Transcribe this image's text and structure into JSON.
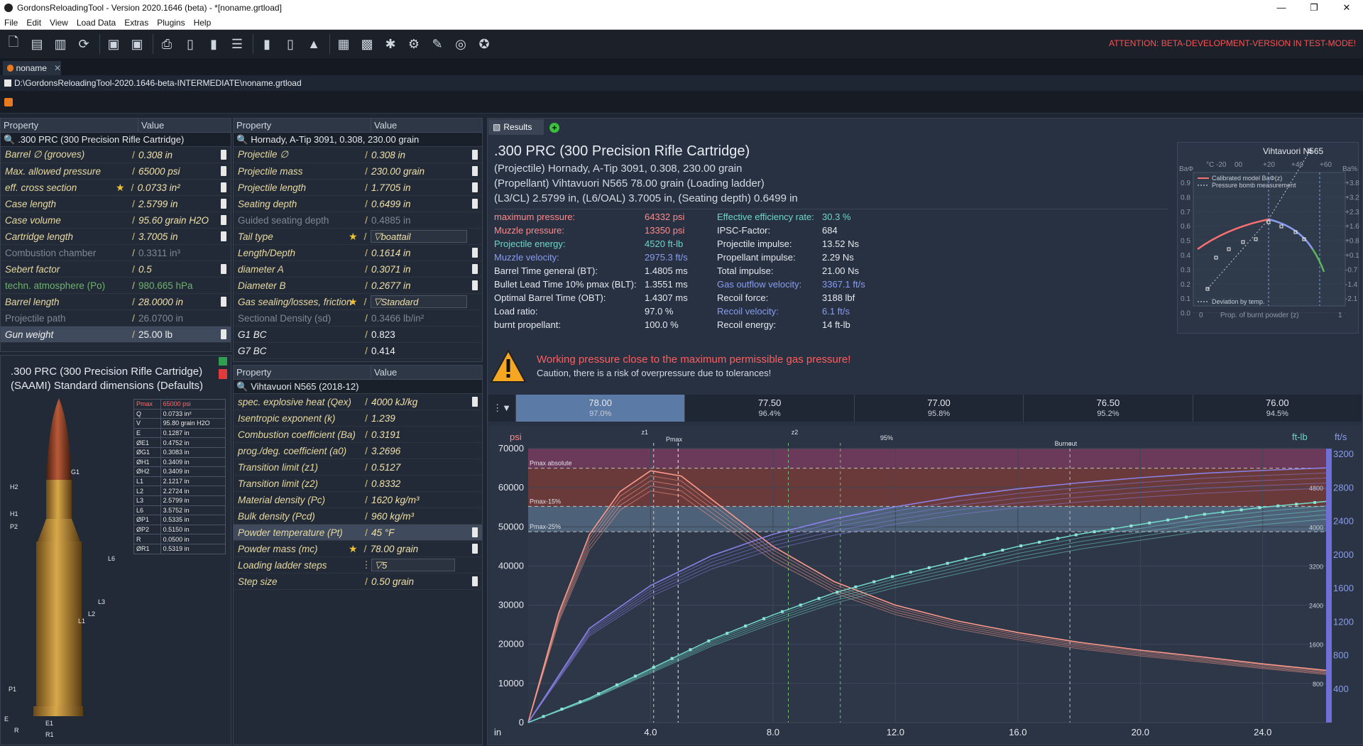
{
  "window": {
    "title": "GordonsReloadingTool - Version 2020.1646 (beta) - *[noname.grtload]",
    "btn_min": "—",
    "btn_max": "❐",
    "btn_close": "✕"
  },
  "menu": [
    "File",
    "Edit",
    "View",
    "Load Data",
    "Extras",
    "Plugins",
    "Help"
  ],
  "attention": "ATTENTION: BETA-DEVELOPMENT-VERSION IN TEST-MODE!",
  "doc_tab": {
    "label": "noname",
    "close": "✕"
  },
  "path": "D:\\GordonsReloadingTool-2020.1646-beta-INTERMEDIATE\\noname.grtload",
  "cartridge_panel": {
    "header_property": "Property",
    "header_value": "Value",
    "title": ".300 PRC (300 Precision Rifle Cartridge)",
    "rows": [
      {
        "k": "Barrel ∅ (grooves)",
        "v": "0.308 in"
      },
      {
        "k": "Max. allowed pressure",
        "v": "65000 psi"
      },
      {
        "k": "eff. cross section",
        "v": "0.0733 in²"
      },
      {
        "k": "Case length",
        "v": "2.5799 in"
      },
      {
        "k": "Case volume",
        "v": "95.60 grain H2O"
      },
      {
        "k": "Cartridge length",
        "v": "3.7005 in"
      },
      {
        "k": "Combustion chamber",
        "v": "0.3311 in³"
      },
      {
        "k": "Sebert factor",
        "v": "0.5"
      },
      {
        "k": "techn. atmosphere (Po)",
        "v": "980.665 hPa"
      },
      {
        "k": "Barrel length",
        "v": "28.0000 in"
      },
      {
        "k": "Projectile path",
        "v": "26.0700 in"
      },
      {
        "k": "Gun weight",
        "v": "25.00 lb"
      }
    ]
  },
  "projectile_panel": {
    "header_property": "Property",
    "header_value": "Value",
    "title": "Hornady, A-Tip 3091, 0.308, 230.00 grain",
    "rows": [
      {
        "k": "Projectile ∅",
        "v": "0.308 in"
      },
      {
        "k": "Projectile mass",
        "v": "230.00 grain"
      },
      {
        "k": "Projectile length",
        "v": "1.7705 in"
      },
      {
        "k": "Seating depth",
        "v": "0.6499 in"
      },
      {
        "k": "Guided seating depth",
        "v": "0.4885 in"
      },
      {
        "k": "Tail type",
        "v": "boattail"
      },
      {
        "k": "Length/Depth",
        "v": "0.1614 in"
      },
      {
        "k": "diameter A",
        "v": "0.3071 in"
      },
      {
        "k": "Diameter B",
        "v": "0.2677 in"
      },
      {
        "k": "Gas sealing/losses, friction",
        "v": "Standard"
      },
      {
        "k": "Sectional Density (sd)",
        "v": "0.3466 lb/in²"
      },
      {
        "k": "G1 BC",
        "v": "0.823"
      },
      {
        "k": "G7 BC",
        "v": "0.414"
      }
    ]
  },
  "propellant_panel": {
    "header_property": "Property",
    "header_value": "Value",
    "title": "Vihtavuori N565 (2018-12)",
    "rows": [
      {
        "k": "spec. explosive heat (Qex)",
        "v": "4000 kJ/kg"
      },
      {
        "k": "Isentropic exponent (k)",
        "v": "1.239"
      },
      {
        "k": "Combustion coefficient (Ba)",
        "v": "0.3191"
      },
      {
        "k": "prog./deg. coefficient (a0)",
        "v": "3.2696"
      },
      {
        "k": "Transition limit (z1)",
        "v": "0.5127"
      },
      {
        "k": "Transition limit (z2)",
        "v": "0.8332"
      },
      {
        "k": "Material density (Pc)",
        "v": "1620 kg/m³"
      },
      {
        "k": "Bulk density (Pcd)",
        "v": "960 kg/m³"
      },
      {
        "k": "Powder temperature (Pt)",
        "v": "45 °F"
      },
      {
        "k": "Powder mass (mc)",
        "v": "78.00 grain"
      },
      {
        "k": "Loading ladder steps",
        "v": "5"
      },
      {
        "k": "Step size",
        "v": "0.50 grain"
      }
    ]
  },
  "cartridge_drawing": {
    "title1": ".300 PRC (300 Precision Rifle Cartridge)",
    "title2": "(SAAMI) Standard dimensions (Defaults)",
    "dims": [
      [
        "Pmax",
        "65000 psi"
      ],
      [
        "Q",
        "0.0733 in²"
      ],
      [
        "V",
        "95.80 grain H2O"
      ],
      [
        "E",
        "0.1287 in"
      ],
      [
        "ØE1",
        "0.4752 in"
      ],
      [
        "ØG1",
        "0.3083 in"
      ],
      [
        "ØH1",
        "0.3409 in"
      ],
      [
        "ØH2",
        "0.3409 in"
      ],
      [
        "L1",
        "2.1217 in"
      ],
      [
        "L2",
        "2.2724 in"
      ],
      [
        "L3",
        "2.5799 in"
      ],
      [
        "L6",
        "3.5752 in"
      ],
      [
        "ØP1",
        "0.5335 in"
      ],
      [
        "ØP2",
        "0.5150 in"
      ],
      [
        "R",
        "0.0500 in"
      ],
      [
        "ØR1",
        "0.5319 in"
      ]
    ],
    "labels": [
      "G1",
      "H2",
      "H1",
      "P2",
      "L6",
      "L3",
      "L2",
      "L1",
      "P1",
      "E1",
      "R1",
      "E",
      "R"
    ]
  },
  "results": {
    "tab": "Results",
    "title": ".300 PRC (300 Precision Rifle Cartridge)",
    "sub1": "(Projectile) Hornady, A-Tip 3091, 0.308, 230.00 grain",
    "sub2": "(Propellant) Vihtavuori N565 78.00 grain (Loading ladder)",
    "sub3": "(L3/CL) 2.5799 in, (L6/OAL) 3.7005 in, (Seating depth) 0.6499 in",
    "col1": [
      {
        "k": "maximum pressure:",
        "v": "64332 psi",
        "c": "#ff8a8a"
      },
      {
        "k": "Muzzle pressure:",
        "v": "13350 psi",
        "c": "#ff8a8a"
      },
      {
        "k": "Projectile energy:",
        "v": "4520 ft-lb",
        "c": "#6fd6c6"
      },
      {
        "k": "Muzzle velocity:",
        "v": "2975.3 ft/s",
        "c": "#8a9cf0"
      },
      {
        "k": "Barrel Time general (BT):",
        "v": "1.4805 ms",
        "c": "#e6e9ee"
      },
      {
        "k": "Bullet Lead Time 10% pmax (BLT):",
        "v": "1.3551 ms",
        "c": "#e6e9ee"
      },
      {
        "k": "Optimal Barrel Time (OBT):",
        "v": "1.4307 ms",
        "c": "#e6e9ee"
      },
      {
        "k": "Load ratio:",
        "v": "97.0 %",
        "c": "#e6e9ee"
      },
      {
        "k": "burnt propellant:",
        "v": "100.0 %",
        "c": "#e6e9ee"
      }
    ],
    "col2": [
      {
        "k": "Effective efficiency rate:",
        "v": "30.3 %",
        "c": "#6fd6c6"
      },
      {
        "k": "IPSC-Factor:",
        "v": "684",
        "c": "#e6e9ee"
      },
      {
        "k": "Projectile impulse:",
        "v": "13.52 Ns",
        "c": "#e6e9ee"
      },
      {
        "k": "Propellant impulse:",
        "v": "2.29 Ns",
        "c": "#e6e9ee"
      },
      {
        "k": "Total impulse:",
        "v": "21.00 Ns",
        "c": "#e6e9ee"
      },
      {
        "k": "Gas outflow velocity:",
        "v": "3367.1 ft/s",
        "c": "#8a9cf0"
      },
      {
        "k": "Recoil force:",
        "v": "3188 lbf",
        "c": "#e6e9ee"
      },
      {
        "k": "Recoil velocity:",
        "v": "6.1 ft/s",
        "c": "#8a9cf0"
      },
      {
        "k": "Recoil energy:",
        "v": "14 ft-lb",
        "c": "#e6e9ee"
      }
    ],
    "warning_title": "Working pressure close to the maximum permissible gas pressure!",
    "warning_text": "Caution, there is a risk of overpressure due to tolerances!",
    "ladder": [
      {
        "mass": "78.00",
        "pct": "97.0%"
      },
      {
        "mass": "77.50",
        "pct": "96.4%"
      },
      {
        "mass": "77.00",
        "pct": "95.8%"
      },
      {
        "mass": "76.50",
        "pct": "95.2%"
      },
      {
        "mass": "76.00",
        "pct": "94.5%"
      }
    ]
  },
  "mini_chart": {
    "title": "Vihtavuori N565",
    "legend1": "Calibrated model BaΦ(z)",
    "legend2": "Pressure bomb measurement",
    "legend3": "Deviation by temp.",
    "xlabel": "Prop. of burnt powder (z)",
    "top_axis": [
      "°C -20",
      "00",
      "+20",
      "+40",
      "+60"
    ],
    "left_ticks": [
      "0.9",
      "0.8",
      "0.7",
      "0.6",
      "0.5",
      "0.4",
      "0.3",
      "0.2",
      "0.1",
      "0.0"
    ],
    "right_ticks": [
      "+3.8",
      "+3.2",
      "+2.3",
      "+1.6",
      "+0.8",
      "+0.1",
      "-0.7",
      "-1.4",
      "-2.1"
    ],
    "left_label": "BaΦ",
    "right_label": "Ba%",
    "x0": "0",
    "x1": "1"
  },
  "chart_data": {
    "type": "line",
    "xlabel": "in",
    "x_ticks": [
      "4.0",
      "8.0",
      "12.0",
      "16.0",
      "20.0",
      "24.0"
    ],
    "y_left_label": "psi",
    "y_left_ticks": [
      "70000",
      "60000",
      "50000",
      "40000",
      "30000",
      "20000",
      "10000",
      "0"
    ],
    "y_right1_label": "ft-lb",
    "y_right1_ticks": [
      "4800",
      "4000",
      "3200",
      "2400",
      "1600",
      "800"
    ],
    "y_right2_label": "ft/s",
    "y_right2_ticks": [
      "3200",
      "2800",
      "2400",
      "2000",
      "1600",
      "1200",
      "800",
      "400"
    ],
    "annotations": [
      "Pmax absolute",
      "Pmax-15%",
      "Pmax-25%",
      "Pmax",
      "z1",
      "z2",
      "95%",
      "Burnout"
    ],
    "xlim": [
      0,
      26.07
    ],
    "ylim": [
      0,
      70000
    ],
    "series": [
      {
        "name": "pressure",
        "color": "#ff9a8a",
        "x": [
          0,
          1,
          2,
          3,
          4,
          5,
          6,
          8,
          10,
          12,
          14,
          16,
          18,
          20,
          22,
          24,
          26.07
        ],
        "y": [
          0,
          28000,
          48000,
          59000,
          64332,
          63000,
          57000,
          45000,
          36000,
          30000,
          26000,
          23000,
          20500,
          18500,
          16800,
          15000,
          13350
        ]
      },
      {
        "name": "velocity",
        "color": "#8a80e6",
        "x": [
          0,
          2,
          4,
          6,
          8,
          10,
          12,
          14,
          16,
          18,
          20,
          22,
          24,
          26.07
        ],
        "y": [
          0,
          1100,
          1600,
          1950,
          2200,
          2380,
          2520,
          2640,
          2730,
          2800,
          2860,
          2910,
          2945,
          2975
        ]
      },
      {
        "name": "energy",
        "color": "#6fd6c6",
        "x": [
          0,
          2,
          4,
          6,
          8,
          10,
          12,
          14,
          16,
          18,
          20,
          22,
          24,
          26.07
        ],
        "y": [
          0,
          500,
          1100,
          1700,
          2200,
          2650,
          3000,
          3300,
          3600,
          3850,
          4050,
          4250,
          4400,
          4520
        ]
      }
    ]
  }
}
